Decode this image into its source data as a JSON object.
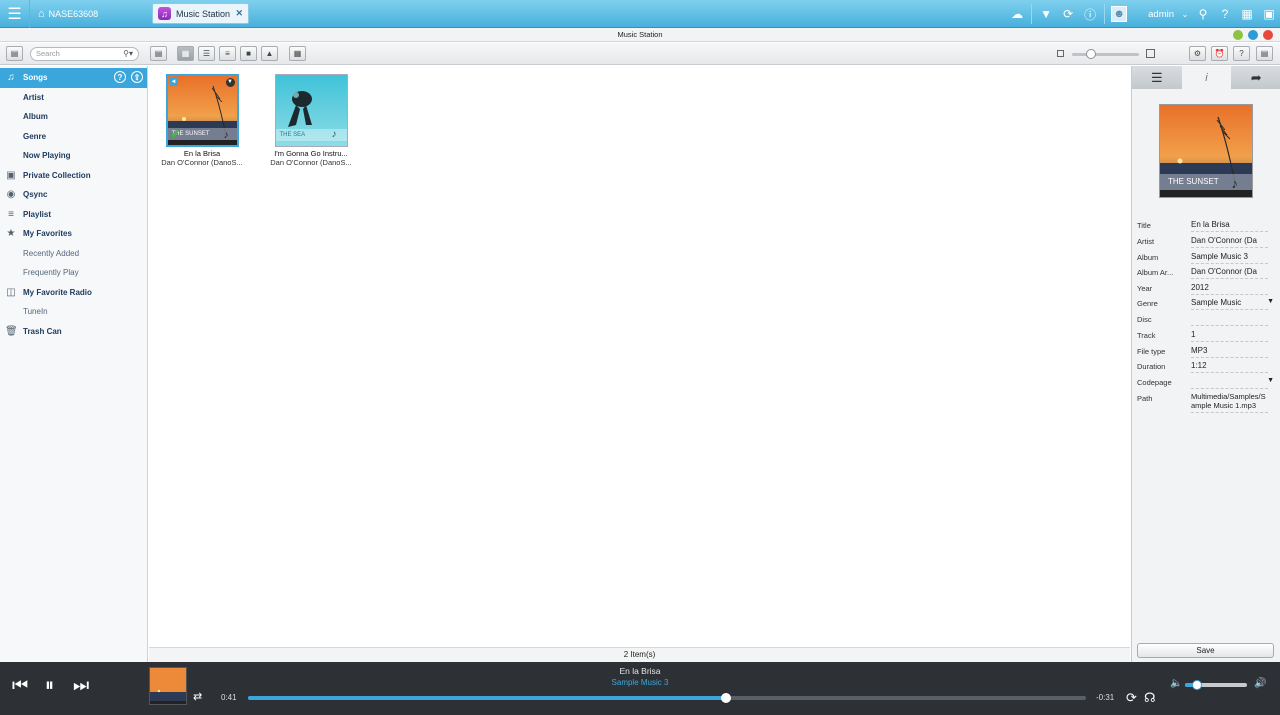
{
  "topbar": {
    "home_label": "NASE63608",
    "app_tab_label": "Music Station",
    "user": "admin"
  },
  "window": {
    "title": "Music Station"
  },
  "toolbar": {
    "search_placeholder": "Search"
  },
  "sidebar": {
    "items": [
      {
        "label": "Songs"
      },
      {
        "label": "Artist"
      },
      {
        "label": "Album"
      },
      {
        "label": "Genre"
      },
      {
        "label": "Now Playing"
      },
      {
        "label": "Private Collection"
      },
      {
        "label": "Qsync"
      },
      {
        "label": "Playlist"
      },
      {
        "label": "My Favorites"
      },
      {
        "label": "Recently Added"
      },
      {
        "label": "Frequently Play"
      },
      {
        "label": "My Favorite Radio"
      },
      {
        "label": "TuneIn"
      },
      {
        "label": "Trash Can"
      }
    ]
  },
  "songs": [
    {
      "title": "En la Brisa",
      "artist": "Dan O'Connor (DanoS...",
      "cover_label": "THE SUNSET",
      "selected": true
    },
    {
      "title": "I'm Gonna Go Instru...",
      "artist": "Dan O'Connor (DanoS...",
      "cover_label": "THE SEA",
      "selected": false
    }
  ],
  "status": {
    "count": "2 Item(s)"
  },
  "details": {
    "cover_label": "THE SUNSET",
    "fields": [
      {
        "key": "Title",
        "value": "En la Brisa"
      },
      {
        "key": "Artist",
        "value": "Dan O'Connor (Da"
      },
      {
        "key": "Album",
        "value": "Sample Music 3"
      },
      {
        "key": "Album Ar...",
        "value": "Dan O'Connor (Da"
      },
      {
        "key": "Year",
        "value": "2012"
      },
      {
        "key": "Genre",
        "value": "Sample Music"
      },
      {
        "key": "Disc",
        "value": ""
      },
      {
        "key": "Track",
        "value": "1"
      },
      {
        "key": "File type",
        "value": "MP3"
      },
      {
        "key": "Duration",
        "value": "1:12"
      },
      {
        "key": "Codepage",
        "value": ""
      },
      {
        "key": "Path",
        "value": "Multimedia/Samples/Sample Music 1.mp3"
      }
    ],
    "save_label": "Save"
  },
  "player": {
    "title": "En la Brisa",
    "album": "Sample Music 3",
    "elapsed": "0:41",
    "remaining": "-0:31",
    "progress_fraction": 0.57,
    "volume_fraction": 0.2
  },
  "colors": {
    "accent": "#3ba6dc",
    "topbar": "#48b0dc",
    "player_bg": "#2d3136"
  }
}
